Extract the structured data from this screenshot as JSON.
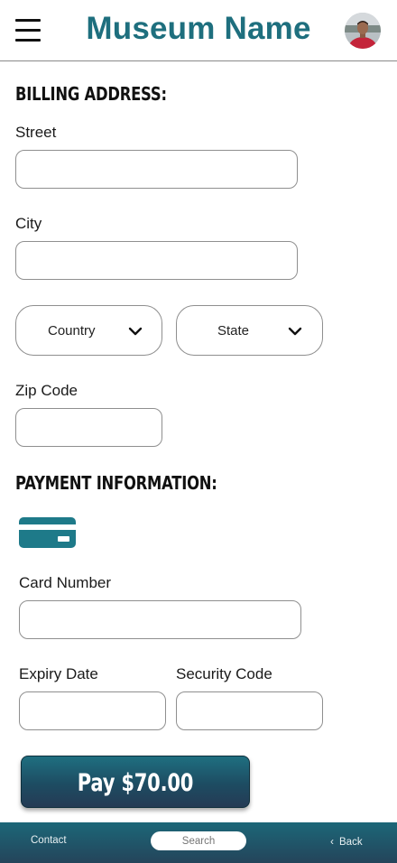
{
  "header": {
    "title": "Museum Name",
    "menu_icon": "hamburger-menu-icon",
    "avatar_icon": "user-avatar"
  },
  "billing": {
    "heading": "Billing Address:",
    "street_label": "Street",
    "street_value": "",
    "city_label": "City",
    "city_value": "",
    "country_select": "Country",
    "state_select": "State",
    "zip_label": "Zip Code",
    "zip_value": ""
  },
  "payment": {
    "heading": "Payment Information:",
    "card_icon": "credit-card-icon",
    "card_number_label": "Card Number",
    "expiry_label": "Expiry Date",
    "security_label": "Security Code",
    "pay_button": "Pay $70.00"
  },
  "footer": {
    "contact": "Contact",
    "search_placeholder": "Search",
    "back": "Back"
  },
  "colors": {
    "brand": "#1e6f7e",
    "button_top": "#1f6f80",
    "button_bottom": "#253b55"
  }
}
